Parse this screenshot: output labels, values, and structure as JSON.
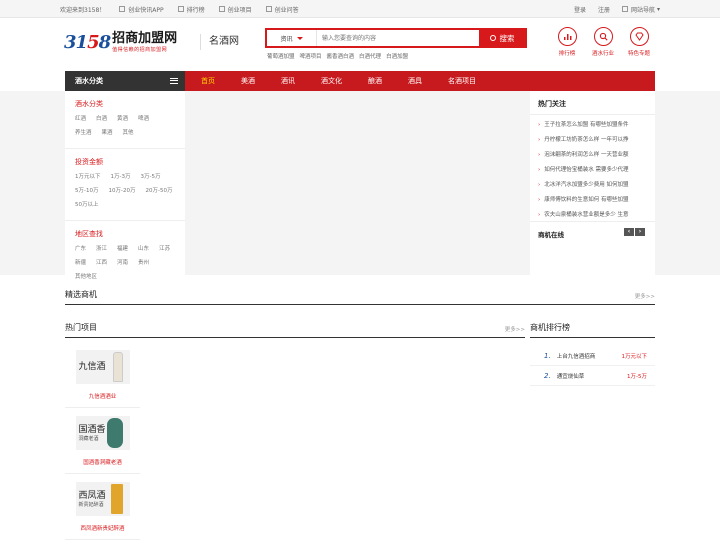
{
  "topbar": {
    "welcome": "欢迎来到3158！",
    "app": "创业快讯APP",
    "ranking": "排行榜",
    "projects": "创业项目",
    "qa": "创业问答",
    "login": "登录",
    "register": "注册",
    "sitenav": "网站导航"
  },
  "header": {
    "logo_num_a": "31",
    "logo_num_b": "5",
    "logo_num_c": "8",
    "logo_title": "招商加盟网",
    "logo_slogan": "值得信赖的招商加盟网",
    "site_name": "名酒网",
    "search_type": "资讯",
    "search_placeholder": "输入您要查询的内容",
    "search_button": "搜索",
    "hotwords": [
      "葡萄酒加盟",
      "啤酒项目",
      "酱香酒白酒",
      "白酒代理",
      "白酒加盟"
    ],
    "quick": [
      {
        "label": "排行榜",
        "icon": "bar-chart-icon"
      },
      {
        "label": "酒水行业",
        "icon": "search-icon"
      },
      {
        "label": "特色专题",
        "icon": "gem-icon"
      }
    ]
  },
  "nav": {
    "category_label": "酒水分类",
    "links": [
      "首页",
      "美酒",
      "酒讯",
      "酒文化",
      "酿酒",
      "酒具",
      "名酒项目"
    ]
  },
  "left": {
    "sections": [
      {
        "title": "酒水分类",
        "options": [
          "红酒",
          "白酒",
          "黄酒",
          "啤酒",
          "养生酒",
          "果酒",
          "其他"
        ]
      },
      {
        "title": "投资金额",
        "options": [
          "1万元以下",
          "1万-3万",
          "3万-5万",
          "5万-10万",
          "10万-20万",
          "20万-50万",
          "50万以上"
        ]
      },
      {
        "title": "地区查找",
        "options": [
          "广东",
          "浙江",
          "福建",
          "山东",
          "江苏",
          "新疆",
          "江西",
          "河南",
          "贵州",
          "其他地区"
        ]
      }
    ]
  },
  "right": {
    "hot_title": "热门关注",
    "hot_items": [
      "王子拉茶怎么加盟 有哪些加盟条件",
      "丹柠檬工坊奶茶怎么样 一年可以挣",
      "泡沫翩茶的利润怎么样 一天营业额",
      "如何代理怡宝桶装水 需要多少代理",
      "北冰洋汽水加盟多少费用 如何加盟",
      "康师傅饮料的生意如何 有哪些加盟",
      "农夫山泉桶装水营业额是多少 生意"
    ],
    "online_title": "商机在线",
    "prev": "‹",
    "next": "›"
  },
  "featured": {
    "title": "精选商机",
    "more": "更多>>"
  },
  "hot_projects": {
    "title": "热门项目",
    "more": "更多>>",
    "items": [
      {
        "name": "九信酒",
        "sub": "",
        "caption": "九信酒酒业",
        "color": "#e9e3d6"
      },
      {
        "name": "国酒香",
        "sub": "洞藏老酒",
        "caption": "国酒香洞藏老酒",
        "color": "#3f7a6e"
      },
      {
        "name": "西凤酒",
        "sub": "新贵妃醉酒",
        "caption": "西凤酒新贵妃醉酒",
        "color": "#e2a52c"
      }
    ]
  },
  "rank": {
    "title": "商机排行榜",
    "items": [
      {
        "n": "1.",
        "name": "上台九信酒招商",
        "value": "1万元以下"
      },
      {
        "n": "2.",
        "name": "通宜烧仙草",
        "value": "1万-5万"
      }
    ]
  }
}
